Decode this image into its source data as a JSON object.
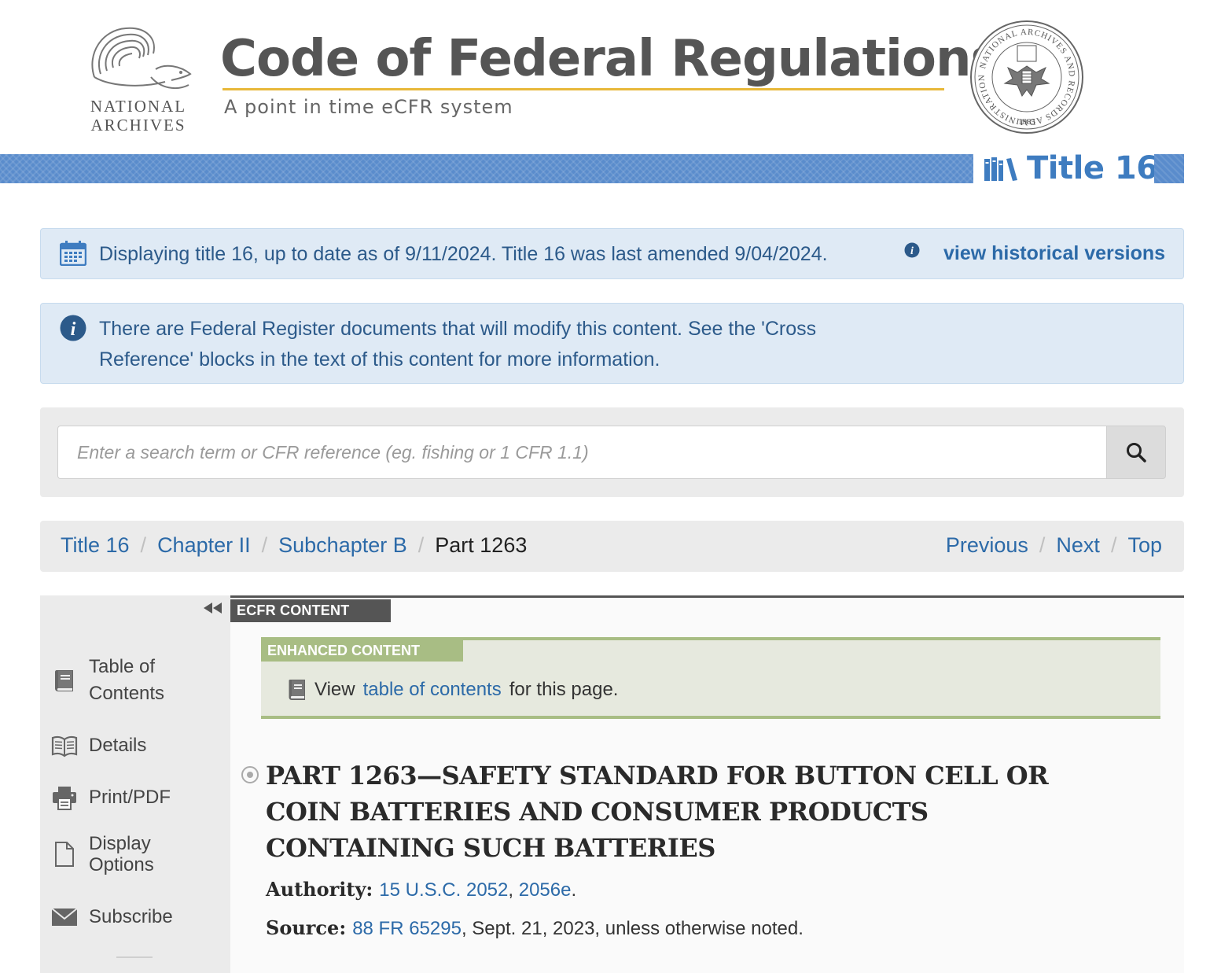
{
  "header": {
    "logo_text": "NATIONAL ARCHIVES",
    "title": "Code of Federal Regulations",
    "subtitle": "A point in time eCFR system",
    "seal_text": "NATIONAL ARCHIVES AND RECORDS ADMINISTRATION",
    "seal_year": "1985"
  },
  "title_bar": {
    "label": "Title 16"
  },
  "date_alert": {
    "message": "Displaying title 16, up to date as of 9/11/2024. Title 16 was last amended 9/04/2024.",
    "link": "view historical versions"
  },
  "fr_alert": {
    "message": "There are Federal Register documents that will modify this content. See the 'Cross Reference' blocks in the text of this content for more information."
  },
  "search": {
    "placeholder": "Enter a search term or CFR reference (eg. fishing or 1 CFR 1.1)",
    "value": ""
  },
  "breadcrumb": {
    "items": [
      "Title 16",
      "Chapter II",
      "Subchapter B"
    ],
    "current": "Part 1263",
    "separator": "/"
  },
  "pager": {
    "previous": "Previous",
    "next": "Next",
    "top": "Top"
  },
  "sidebar": {
    "items": [
      {
        "label": "Table of Contents",
        "icon": "book-icon"
      },
      {
        "label": "Details",
        "icon": "open-book-icon"
      },
      {
        "label": "Print/PDF",
        "icon": "printer-icon"
      },
      {
        "label": "Display Options",
        "icon": "document-icon"
      },
      {
        "label": "Subscribe",
        "icon": "envelope-icon"
      }
    ]
  },
  "content": {
    "tag": "ECFR CONTENT",
    "enhanced_tag": "ENHANCED CONTENT",
    "enhanced_pre": "View",
    "enhanced_link": "table of contents",
    "enhanced_post": "for this page.",
    "part_heading": "PART 1263—SAFETY STANDARD FOR BUTTON CELL OR COIN BATTERIES AND CONSUMER PRODUCTS CONTAINING SUCH BATTERIES",
    "authority_label": "Authority:",
    "authority_link1": "15 U.S.C. 2052",
    "authority_comma": ",",
    "authority_link2": "2056e",
    "authority_end": ".",
    "source_label": "Source:",
    "source_link": "88 FR 65295",
    "source_rest": ", Sept. 21, 2023, unless otherwise noted."
  },
  "colors": {
    "brand_blue": "#5a8ccc",
    "link_blue": "#2c6aa8",
    "alert_bg": "#dfeaf5",
    "gold_rule": "#e8b83a",
    "enhanced_green": "#a8bd84"
  }
}
